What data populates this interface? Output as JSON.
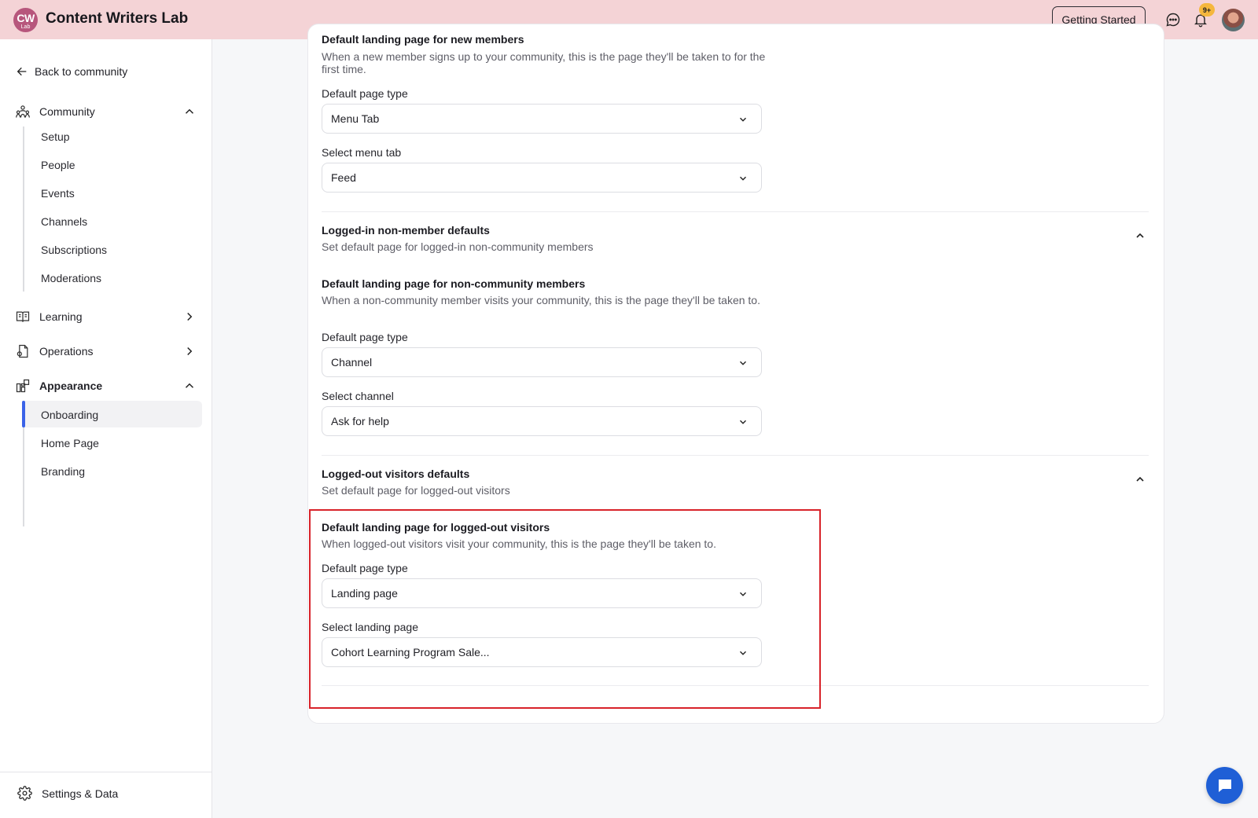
{
  "header": {
    "logo": {
      "line1": "CW",
      "line2": "Lab"
    },
    "title": "Content Writers Lab",
    "getting_started": "Getting Started",
    "notification_badge": "9+"
  },
  "sidebar": {
    "back_label": "Back to community",
    "groups": [
      {
        "label": "Community",
        "icon": "community-icon",
        "expanded": true,
        "items": [
          "Setup",
          "People",
          "Events",
          "Channels",
          "Subscriptions",
          "Moderations"
        ]
      },
      {
        "label": "Learning",
        "icon": "book-icon",
        "expanded": false
      },
      {
        "label": "Operations",
        "icon": "document-icon",
        "expanded": false
      },
      {
        "label": "Appearance",
        "icon": "layout-icon",
        "expanded": true,
        "items": [
          "Onboarding",
          "Home Page",
          "Branding"
        ],
        "active_item": "Onboarding"
      }
    ],
    "settings_label": "Settings & Data"
  },
  "main": {
    "new_members": {
      "title": "Default landing page for new members",
      "description": "When a new member signs up to your community, this is the page they'll be taken to for the first time.",
      "page_type_label": "Default page type",
      "page_type_value": "Menu Tab",
      "select_label": "Select menu tab",
      "select_value": "Feed"
    },
    "non_member_section": {
      "title": "Logged-in non-member defaults",
      "subtitle": "Set default page for logged-in non-community members",
      "landing_title": "Default landing page for non-community members",
      "landing_description": "When a non-community member visits your community, this is the page they'll be taken to.",
      "page_type_label": "Default page type",
      "page_type_value": "Channel",
      "select_label": "Select channel",
      "select_value": "Ask for help"
    },
    "logged_out_section": {
      "title": "Logged-out visitors defaults",
      "subtitle": "Set default page for logged-out visitors",
      "landing_title": "Default landing page for logged-out visitors",
      "landing_description": "When logged-out visitors visit your community, this is the page they'll be taken to.",
      "page_type_label": "Default page type",
      "page_type_value": "Landing page",
      "select_label": "Select landing page",
      "select_value": "Cohort Learning Program Sale..."
    }
  },
  "colors": {
    "header_bg": "#f4d3d6",
    "logo_bg": "#b7567c",
    "accent": "#3b63e8",
    "highlight_border": "#d8232a",
    "fab_bg": "#1f5fd6",
    "badge_bg": "#f5b73d"
  }
}
